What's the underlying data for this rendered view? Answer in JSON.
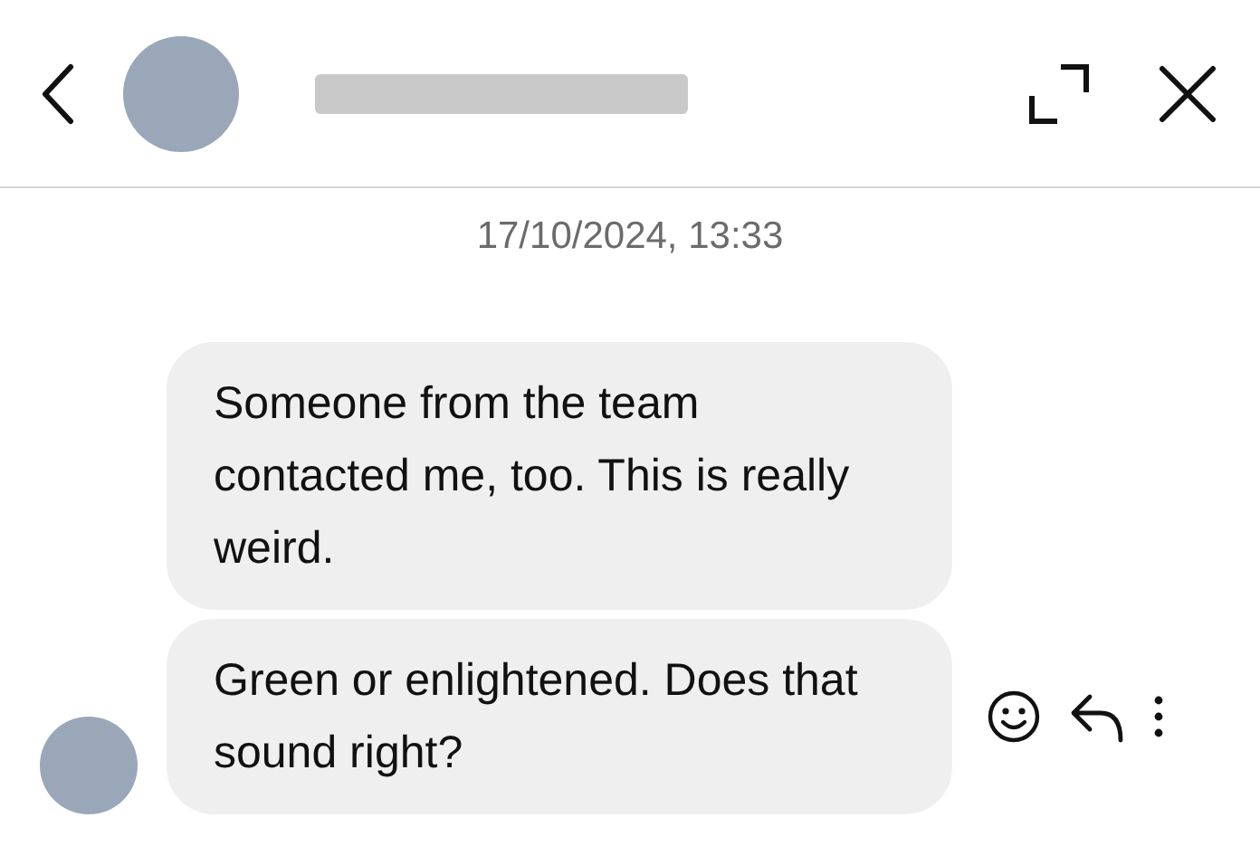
{
  "timestamp": "17/10/2024, 13:33",
  "messages": [
    {
      "text": "Someone from the team contacted me, too. This is really weird."
    },
    {
      "text": "Green or enlightened. Does that sound right?"
    }
  ]
}
